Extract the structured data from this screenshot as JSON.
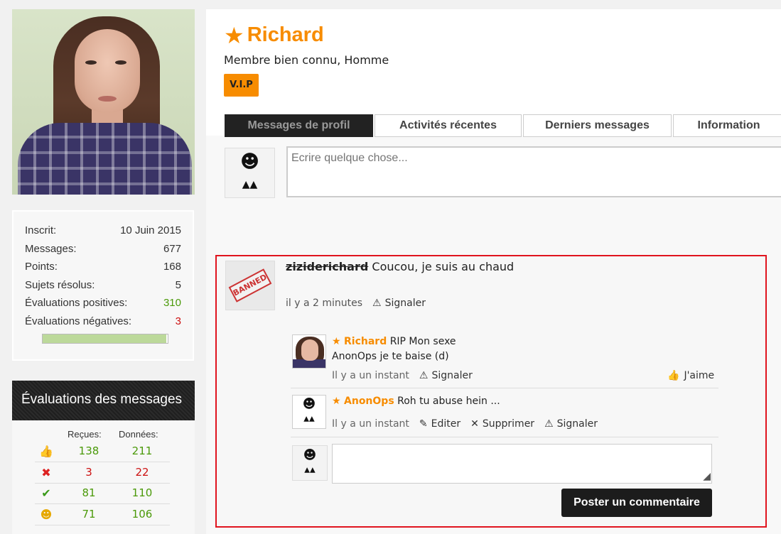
{
  "profile": {
    "name": "Richard",
    "subtitle": "Membre bien connu, Homme",
    "badge": "V.I.P",
    "accent_color": "#f78c00"
  },
  "tabs": [
    {
      "label": "Messages de profil",
      "active": true
    },
    {
      "label": "Activités récentes",
      "active": false
    },
    {
      "label": "Derniers messages",
      "active": false
    },
    {
      "label": "Information",
      "active": false
    }
  ],
  "stats": {
    "rows": [
      {
        "label": "Inscrit:",
        "value": "10 Juin 2015"
      },
      {
        "label": "Messages:",
        "value": "677"
      },
      {
        "label": "Points:",
        "value": "168"
      },
      {
        "label": "Sujets résolus:",
        "value": "5"
      },
      {
        "label": "Évaluations positives:",
        "value": "310"
      },
      {
        "label": "Évaluations négatives:",
        "value": "3"
      }
    ],
    "rating_ratio": 0.99
  },
  "ratings": {
    "title": "Évaluations des messages",
    "col_received": "Reçues:",
    "col_given": "Données:",
    "rows": [
      {
        "icon": "thumbs-up-icon",
        "received": "138",
        "given": "211",
        "color": "green"
      },
      {
        "icon": "cross-icon",
        "received": "3",
        "given": "22",
        "color": "red"
      },
      {
        "icon": "checkmark-icon",
        "received": "81",
        "given": "110",
        "color": "green"
      },
      {
        "icon": "smiley-icon",
        "received": "71",
        "given": "106",
        "color": "green"
      }
    ]
  },
  "compose": {
    "placeholder": "Ecrire quelque chose..."
  },
  "message": {
    "author": "ziziderichard",
    "text": "Coucou, je suis au chaud",
    "time": "il y a 2 minutes",
    "report": "Signaler",
    "banned_label": "BANNED"
  },
  "comments": [
    {
      "author": "Richard",
      "line1": "RIP Mon sexe",
      "line2": "AnonOps je te baise (d)",
      "time": "Il y a un instant",
      "report": "Signaler",
      "like": "J'aime"
    },
    {
      "author": "AnonOps",
      "line1": "Roh tu abuse hein ...",
      "time": "Il y a un instant",
      "edit": "Editer",
      "delete": "Supprimer",
      "report": "Signaler"
    }
  ],
  "reply": {
    "button": "Poster un commentaire"
  }
}
